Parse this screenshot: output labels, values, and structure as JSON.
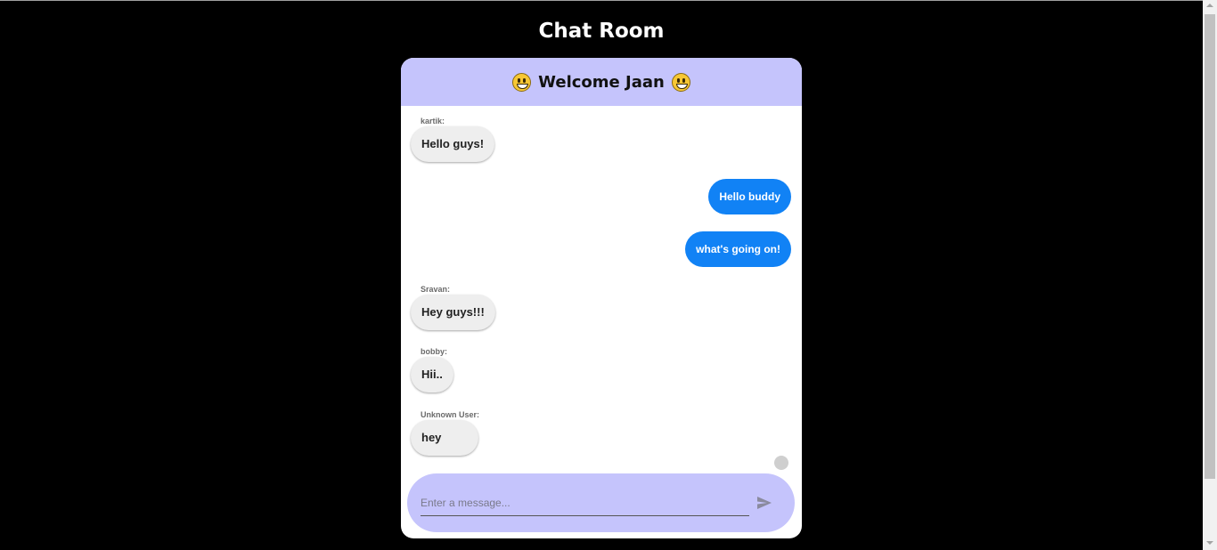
{
  "page": {
    "title": "Chat Room"
  },
  "chat": {
    "header": {
      "text": "Welcome Jaan",
      "emoji_icon": "grinning-face-icon"
    },
    "messages": [
      {
        "sender": "kartik:",
        "text": "Hello guys!",
        "direction": "incoming"
      },
      {
        "sender": "",
        "text": "Hello buddy",
        "direction": "outgoing"
      },
      {
        "sender": "",
        "text": "what's going on!",
        "direction": "outgoing"
      },
      {
        "sender": "Sravan:",
        "text": "Hey guys!!!",
        "direction": "incoming"
      },
      {
        "sender": "bobby:",
        "text": "Hii..",
        "direction": "incoming"
      },
      {
        "sender": "Unknown User:",
        "text": "hey",
        "direction": "incoming"
      }
    ],
    "composer": {
      "placeholder": "Enter a message...",
      "value": "",
      "send_icon": "send-icon"
    }
  },
  "colors": {
    "background": "#000000",
    "header": "#c5c4fc",
    "outgoing_bubble": "#1182f5",
    "incoming_bubble": "#eeeeee",
    "composer": "#c5c4fc"
  }
}
